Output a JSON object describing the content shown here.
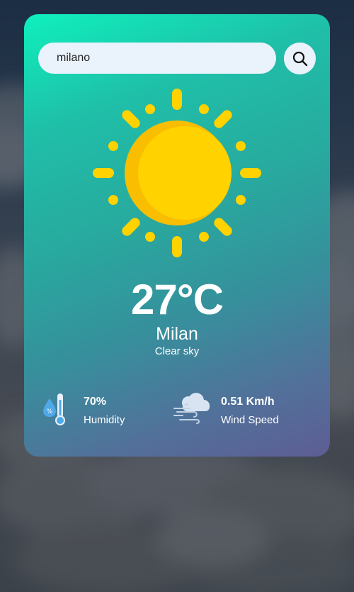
{
  "search": {
    "value": "milano",
    "button_icon": "search-icon"
  },
  "weather": {
    "icon": "sun-icon",
    "temperature": "27°C",
    "city": "Milan",
    "description": "Clear sky"
  },
  "details": {
    "humidity": {
      "icon": "humidity-thermometer-icon",
      "value": "70%",
      "label": "Humidity"
    },
    "wind": {
      "icon": "wind-cloud-icon",
      "value": "0.51 Km/h",
      "label": "Wind Speed"
    }
  },
  "colors": {
    "card_gradient_top": "#0ff0bd",
    "card_gradient_bottom": "#5d5d94",
    "sun": "#ffd200",
    "sun_shade": "#f9be00",
    "input_bg": "#eaf2fc"
  }
}
